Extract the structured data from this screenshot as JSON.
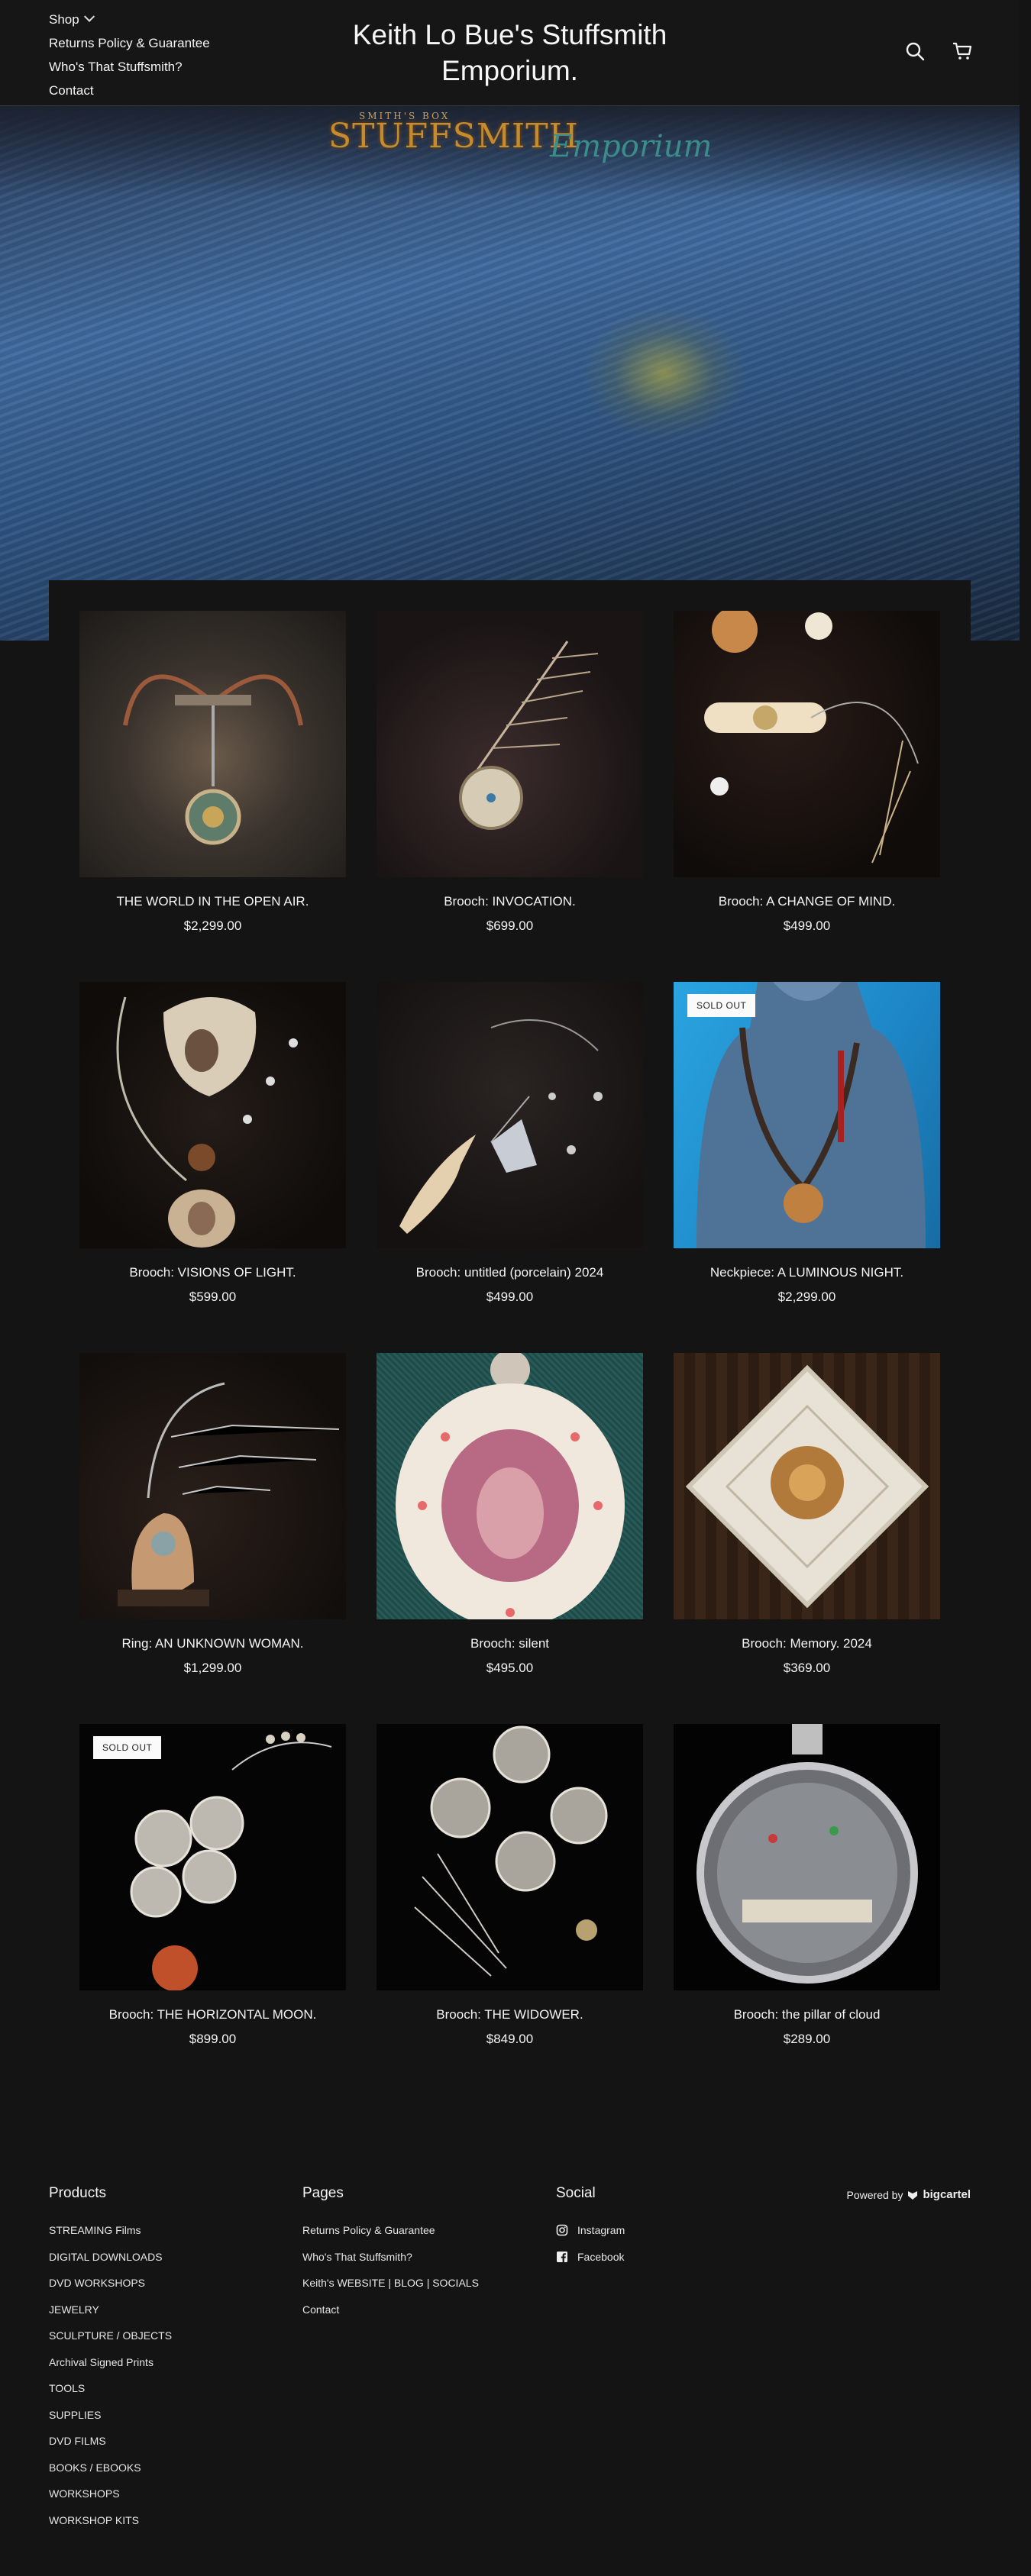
{
  "header": {
    "nav": [
      "Shop",
      "Returns Policy & Guarantee",
      "Who's That Stuffsmith?",
      "Contact"
    ],
    "title": "Keith Lo Bue's Stuffsmith Emporium."
  },
  "hero": {
    "logo_small": "SMITH'S BOX",
    "logo_main": "STUFFSMITH",
    "logo_script": "Emporium"
  },
  "products": [
    {
      "name": "THE WORLD IN THE OPEN AIR.",
      "price": "$2,299.00",
      "sold_out": false
    },
    {
      "name": "Brooch: INVOCATION.",
      "price": "$699.00",
      "sold_out": false
    },
    {
      "name": "Brooch: A CHANGE OF MIND.",
      "price": "$499.00",
      "sold_out": false
    },
    {
      "name": "Brooch: VISIONS OF LIGHT.",
      "price": "$599.00",
      "sold_out": false
    },
    {
      "name": "Brooch: untitled (porcelain) 2024",
      "price": "$499.00",
      "sold_out": false
    },
    {
      "name": "Neckpiece: A LUMINOUS NIGHT.",
      "price": "$2,299.00",
      "sold_out": true
    },
    {
      "name": "Ring: AN UNKNOWN WOMAN.",
      "price": "$1,299.00",
      "sold_out": false
    },
    {
      "name": "Brooch: silent",
      "price": "$495.00",
      "sold_out": false
    },
    {
      "name": "Brooch: Memory. 2024",
      "price": "$369.00",
      "sold_out": false
    },
    {
      "name": "Brooch: THE HORIZONTAL MOON.",
      "price": "$899.00",
      "sold_out": true
    },
    {
      "name": "Brooch: THE WIDOWER.",
      "price": "$849.00",
      "sold_out": false
    },
    {
      "name": "Brooch: the pillar of cloud",
      "price": "$289.00",
      "sold_out": false
    }
  ],
  "sold_out_label": "SOLD OUT",
  "footer": {
    "products_heading": "Products",
    "products": [
      "STREAMING Films",
      "DIGITAL DOWNLOADS",
      "DVD WORKSHOPS",
      "JEWELRY",
      "SCULPTURE / OBJECTS",
      "Archival Signed Prints",
      "TOOLS",
      "SUPPLIES",
      "DVD FILMS",
      "BOOKS / EBOOKS",
      "WORKSHOPS",
      "WORKSHOP KITS"
    ],
    "pages_heading": "Pages",
    "pages": [
      "Returns Policy & Guarantee",
      "Who's That Stuffsmith?",
      "Keith's WEBSITE | BLOG | SOCIALS",
      "Contact"
    ],
    "social_heading": "Social",
    "social": [
      {
        "label": "Instagram",
        "icon": "instagram-icon"
      },
      {
        "label": "Facebook",
        "icon": "facebook-icon"
      }
    ],
    "powered_by": "Powered by",
    "powered_brand": "bigcartel"
  },
  "colors": {
    "background": "#141414",
    "text": "#f4f4f4"
  }
}
